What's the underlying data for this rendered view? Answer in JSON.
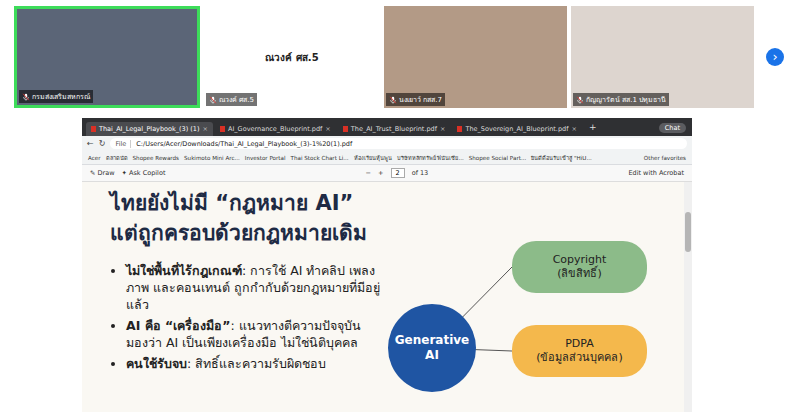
{
  "meeting": {
    "participants": [
      {
        "name": "กรมส่งเสริมสหกรณ์",
        "video": true,
        "speaking": true,
        "muted": true,
        "color": "#5b6577"
      },
      {
        "name": "ณวงค์ ศส.5",
        "video": false,
        "speaking": false,
        "muted": true,
        "color": "#ffffff"
      },
      {
        "name": "นงเยาว์ กสส.7",
        "video": true,
        "speaking": false,
        "muted": true,
        "color": "#b39a86"
      },
      {
        "name": "กัญญารัตน์ สส.1 ปทุมธานี",
        "video": true,
        "speaking": false,
        "muted": true,
        "color": "#ddd5cf"
      }
    ],
    "next_button": "›"
  },
  "browser": {
    "tabs": [
      {
        "label": "Thai_AI_Legal_Playbook_(3) (1)",
        "selected": true,
        "close": "×"
      },
      {
        "label": "AI_Governance_Blueprint.pdf",
        "selected": false,
        "close": "×"
      },
      {
        "label": "The_AI_Trust_Blueprint.pdf",
        "selected": false,
        "close": "×"
      },
      {
        "label": "The_Sovereign_AI_Blueprint.pdf",
        "selected": false,
        "close": "×"
      }
    ],
    "new_tab": "+",
    "chat": "Chat",
    "address": {
      "scheme": "File",
      "path": "C:/Users/Acer/Downloads/Thai_AI_Legal_Playbook_(3)-1%20(1).pdf"
    },
    "bookmarks": [
      "Acer",
      "ตลาดนัด",
      "Shopee Rewards",
      "Sukimoto Mini Arc...",
      "Investor Portal",
      "Thai Stock Chart Li...",
      "ห้องเรียนหุ้นพูน",
      "บริษัทหลักทรัพย์ ฟินันเซีย...",
      "Shopee Social Part...",
      "ยินดีต้อนรับเข้าสู่ \"HiU..."
    ],
    "other_bookmarks": "Other favorites",
    "pdf_toolbar": {
      "draw": "Draw",
      "copilot": "Ask Copilot",
      "zoom_out": "−",
      "zoom_in": "+",
      "page": "2",
      "page_count": "of 13",
      "edit": "Edit with Acrobat"
    }
  },
  "slide": {
    "heading": [
      "ไทยยังไม่มี “กฎหมาย AI”",
      "แต่ถูกครอบด้วยกฎหมายเดิม"
    ],
    "bullets": [
      {
        "bold": "ไม่ใช่พื้นที่ไร้กฎเกณฑ์",
        "text": ": การใช้ AI ทำคลิป เพลง ภาพ และคอนเทนต์ ถูกกำกับด้วยกฎหมายที่มีอยู่แล้ว"
      },
      {
        "bold": "AI คือ “เครื่องมือ”",
        "text": ": แนวทางตีความปัจจุบันมองว่า AI เป็นเพียงเครื่องมือ ไม่ใช่นิติบุคคล"
      },
      {
        "bold": "คนใช้รับจบ",
        "text": ": สิทธิ์และความรับผิดชอบ"
      }
    ],
    "diagram": {
      "center": "Generative AI",
      "nodes": [
        {
          "title": "Copyright",
          "subtitle": "(ลิขสิทธิ์)",
          "color": "#8cbb89"
        },
        {
          "title": "PDPA",
          "subtitle": "(ข้อมูลส่วนบุคคล)",
          "color": "#f4b84c"
        }
      ]
    }
  }
}
